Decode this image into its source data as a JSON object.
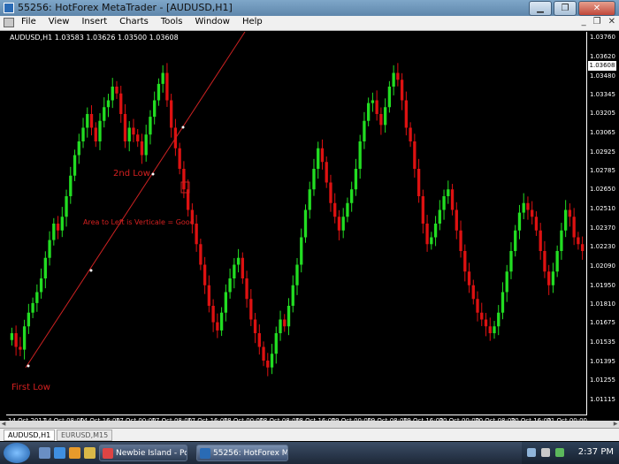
{
  "window": {
    "title": "55256: HotForex MetaTrader - [AUDUSD,H1]"
  },
  "menu": [
    "File",
    "View",
    "Insert",
    "Charts",
    "Tools",
    "Window",
    "Help"
  ],
  "chart_data": {
    "type": "candlestick",
    "symbol_line": "AUDUSD,H1  1.03583 1.03626 1.03500 1.03608",
    "ylim": [
      1.01,
      1.038
    ],
    "y_ticks": [
      "1.03760",
      "1.03620",
      "1.03480",
      "1.03345",
      "1.03205",
      "1.03065",
      "1.02925",
      "1.02785",
      "1.02650",
      "1.02510",
      "1.02370",
      "1.02230",
      "1.02090",
      "1.01950",
      "1.01810",
      "1.01675",
      "1.01535",
      "1.01395",
      "1.01255",
      "1.01115"
    ],
    "current_price": "1.03608",
    "x_ticks": [
      "14 Oct 2011",
      "14 Oct 08:00",
      "14 Oct 16:00",
      "17 Oct 00:00",
      "17 Oct 08:00",
      "17 Oct 16:00",
      "18 Oct 00:00",
      "18 Oct 08:00",
      "18 Oct 16:00",
      "19 Oct 00:00",
      "19 Oct 08:00",
      "19 Oct 16:00",
      "20 Oct 00:00",
      "20 Oct 08:00",
      "20 Oct 16:00",
      "21 Oct 00:00"
    ],
    "annotations": {
      "first_low": "First Low",
      "second_low": "2nd Low",
      "area_note": "Area to Left is Verticale = Good"
    },
    "closes": [
      1.016,
      1.015,
      1.0148,
      1.0165,
      1.0175,
      1.0182,
      1.019,
      1.02,
      1.0215,
      1.0228,
      1.024,
      1.0235,
      1.0245,
      1.026,
      1.0275,
      1.029,
      1.03,
      1.031,
      1.032,
      1.031,
      1.03,
      1.0315,
      1.0325,
      1.033,
      1.034,
      1.0335,
      1.032,
      1.03,
      1.031,
      1.0305,
      1.03,
      1.029,
      1.0305,
      1.0318,
      1.033,
      1.0342,
      1.035,
      1.033,
      1.031,
      1.0295,
      1.028,
      1.0265,
      1.025,
      1.024,
      1.0225,
      1.021,
      1.0195,
      1.018,
      1.0168,
      1.0162,
      1.0175,
      1.019,
      1.02,
      1.021,
      1.0215,
      1.02,
      1.0185,
      1.017,
      1.016,
      1.015,
      1.014,
      1.0135,
      1.0145,
      1.016,
      1.017,
      1.0165,
      1.018,
      1.0195,
      1.021,
      1.023,
      1.025,
      1.0265,
      1.028,
      1.0295,
      1.0285,
      1.027,
      1.0255,
      1.0245,
      1.0235,
      1.0245,
      1.0255,
      1.0265,
      1.028,
      1.03,
      1.0315,
      1.0328,
      1.033,
      1.032,
      1.0312,
      1.0325,
      1.034,
      1.035,
      1.0345,
      1.033,
      1.031,
      1.03,
      1.028,
      1.026,
      1.024,
      1.0225,
      1.023,
      1.024,
      1.025,
      1.026,
      1.0265,
      1.025,
      1.0235,
      1.022,
      1.0205,
      1.0195,
      1.0185,
      1.0175,
      1.017,
      1.0165,
      1.016,
      1.0165,
      1.0175,
      1.019,
      1.0205,
      1.022,
      1.0235,
      1.0248,
      1.0255,
      1.025,
      1.0245,
      1.0235,
      1.022,
      1.0205,
      1.0195,
      1.0205,
      1.022,
      1.0235,
      1.025,
      1.0245,
      1.023,
      1.0225,
      1.022
    ]
  },
  "tabs": [
    {
      "label": "AUDUSD,H1",
      "active": true
    },
    {
      "label": "EURUSD,M15",
      "active": false
    }
  ],
  "taskbar": {
    "tasks": [
      "Newbie Island - Pos...",
      "55256: HotForex Me..."
    ],
    "clock": "2:37 PM"
  },
  "colors": {
    "bull": "#22dd22",
    "bear": "#dd1111",
    "line": "#cc2222",
    "annotation": "#d42020"
  }
}
